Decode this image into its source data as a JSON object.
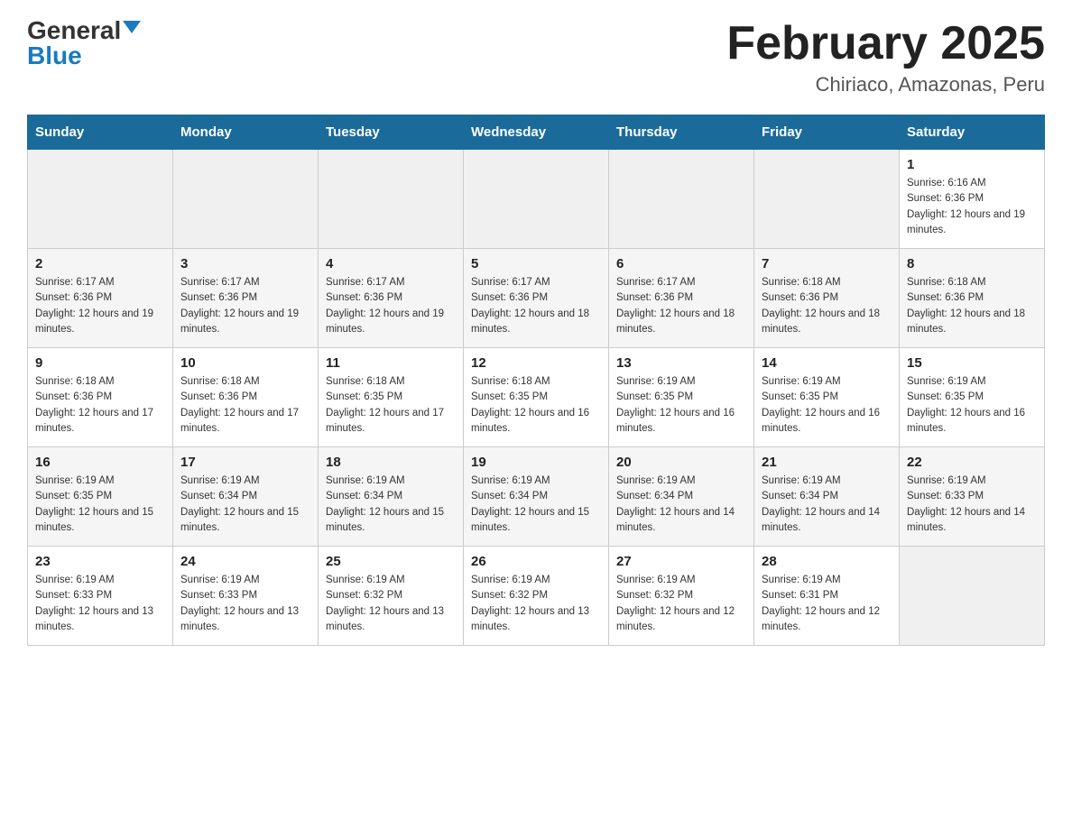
{
  "header": {
    "logo_general": "General",
    "logo_blue": "Blue",
    "calendar_title": "February 2025",
    "calendar_subtitle": "Chiriaco, Amazonas, Peru"
  },
  "days_of_week": [
    "Sunday",
    "Monday",
    "Tuesday",
    "Wednesday",
    "Thursday",
    "Friday",
    "Saturday"
  ],
  "weeks": [
    [
      {
        "day": "",
        "info": ""
      },
      {
        "day": "",
        "info": ""
      },
      {
        "day": "",
        "info": ""
      },
      {
        "day": "",
        "info": ""
      },
      {
        "day": "",
        "info": ""
      },
      {
        "day": "",
        "info": ""
      },
      {
        "day": "1",
        "info": "Sunrise: 6:16 AM\nSunset: 6:36 PM\nDaylight: 12 hours and 19 minutes."
      }
    ],
    [
      {
        "day": "2",
        "info": "Sunrise: 6:17 AM\nSunset: 6:36 PM\nDaylight: 12 hours and 19 minutes."
      },
      {
        "day": "3",
        "info": "Sunrise: 6:17 AM\nSunset: 6:36 PM\nDaylight: 12 hours and 19 minutes."
      },
      {
        "day": "4",
        "info": "Sunrise: 6:17 AM\nSunset: 6:36 PM\nDaylight: 12 hours and 19 minutes."
      },
      {
        "day": "5",
        "info": "Sunrise: 6:17 AM\nSunset: 6:36 PM\nDaylight: 12 hours and 18 minutes."
      },
      {
        "day": "6",
        "info": "Sunrise: 6:17 AM\nSunset: 6:36 PM\nDaylight: 12 hours and 18 minutes."
      },
      {
        "day": "7",
        "info": "Sunrise: 6:18 AM\nSunset: 6:36 PM\nDaylight: 12 hours and 18 minutes."
      },
      {
        "day": "8",
        "info": "Sunrise: 6:18 AM\nSunset: 6:36 PM\nDaylight: 12 hours and 18 minutes."
      }
    ],
    [
      {
        "day": "9",
        "info": "Sunrise: 6:18 AM\nSunset: 6:36 PM\nDaylight: 12 hours and 17 minutes."
      },
      {
        "day": "10",
        "info": "Sunrise: 6:18 AM\nSunset: 6:36 PM\nDaylight: 12 hours and 17 minutes."
      },
      {
        "day": "11",
        "info": "Sunrise: 6:18 AM\nSunset: 6:35 PM\nDaylight: 12 hours and 17 minutes."
      },
      {
        "day": "12",
        "info": "Sunrise: 6:18 AM\nSunset: 6:35 PM\nDaylight: 12 hours and 16 minutes."
      },
      {
        "day": "13",
        "info": "Sunrise: 6:19 AM\nSunset: 6:35 PM\nDaylight: 12 hours and 16 minutes."
      },
      {
        "day": "14",
        "info": "Sunrise: 6:19 AM\nSunset: 6:35 PM\nDaylight: 12 hours and 16 minutes."
      },
      {
        "day": "15",
        "info": "Sunrise: 6:19 AM\nSunset: 6:35 PM\nDaylight: 12 hours and 16 minutes."
      }
    ],
    [
      {
        "day": "16",
        "info": "Sunrise: 6:19 AM\nSunset: 6:35 PM\nDaylight: 12 hours and 15 minutes."
      },
      {
        "day": "17",
        "info": "Sunrise: 6:19 AM\nSunset: 6:34 PM\nDaylight: 12 hours and 15 minutes."
      },
      {
        "day": "18",
        "info": "Sunrise: 6:19 AM\nSunset: 6:34 PM\nDaylight: 12 hours and 15 minutes."
      },
      {
        "day": "19",
        "info": "Sunrise: 6:19 AM\nSunset: 6:34 PM\nDaylight: 12 hours and 15 minutes."
      },
      {
        "day": "20",
        "info": "Sunrise: 6:19 AM\nSunset: 6:34 PM\nDaylight: 12 hours and 14 minutes."
      },
      {
        "day": "21",
        "info": "Sunrise: 6:19 AM\nSunset: 6:34 PM\nDaylight: 12 hours and 14 minutes."
      },
      {
        "day": "22",
        "info": "Sunrise: 6:19 AM\nSunset: 6:33 PM\nDaylight: 12 hours and 14 minutes."
      }
    ],
    [
      {
        "day": "23",
        "info": "Sunrise: 6:19 AM\nSunset: 6:33 PM\nDaylight: 12 hours and 13 minutes."
      },
      {
        "day": "24",
        "info": "Sunrise: 6:19 AM\nSunset: 6:33 PM\nDaylight: 12 hours and 13 minutes."
      },
      {
        "day": "25",
        "info": "Sunrise: 6:19 AM\nSunset: 6:32 PM\nDaylight: 12 hours and 13 minutes."
      },
      {
        "day": "26",
        "info": "Sunrise: 6:19 AM\nSunset: 6:32 PM\nDaylight: 12 hours and 13 minutes."
      },
      {
        "day": "27",
        "info": "Sunrise: 6:19 AM\nSunset: 6:32 PM\nDaylight: 12 hours and 12 minutes."
      },
      {
        "day": "28",
        "info": "Sunrise: 6:19 AM\nSunset: 6:31 PM\nDaylight: 12 hours and 12 minutes."
      },
      {
        "day": "",
        "info": ""
      }
    ]
  ]
}
